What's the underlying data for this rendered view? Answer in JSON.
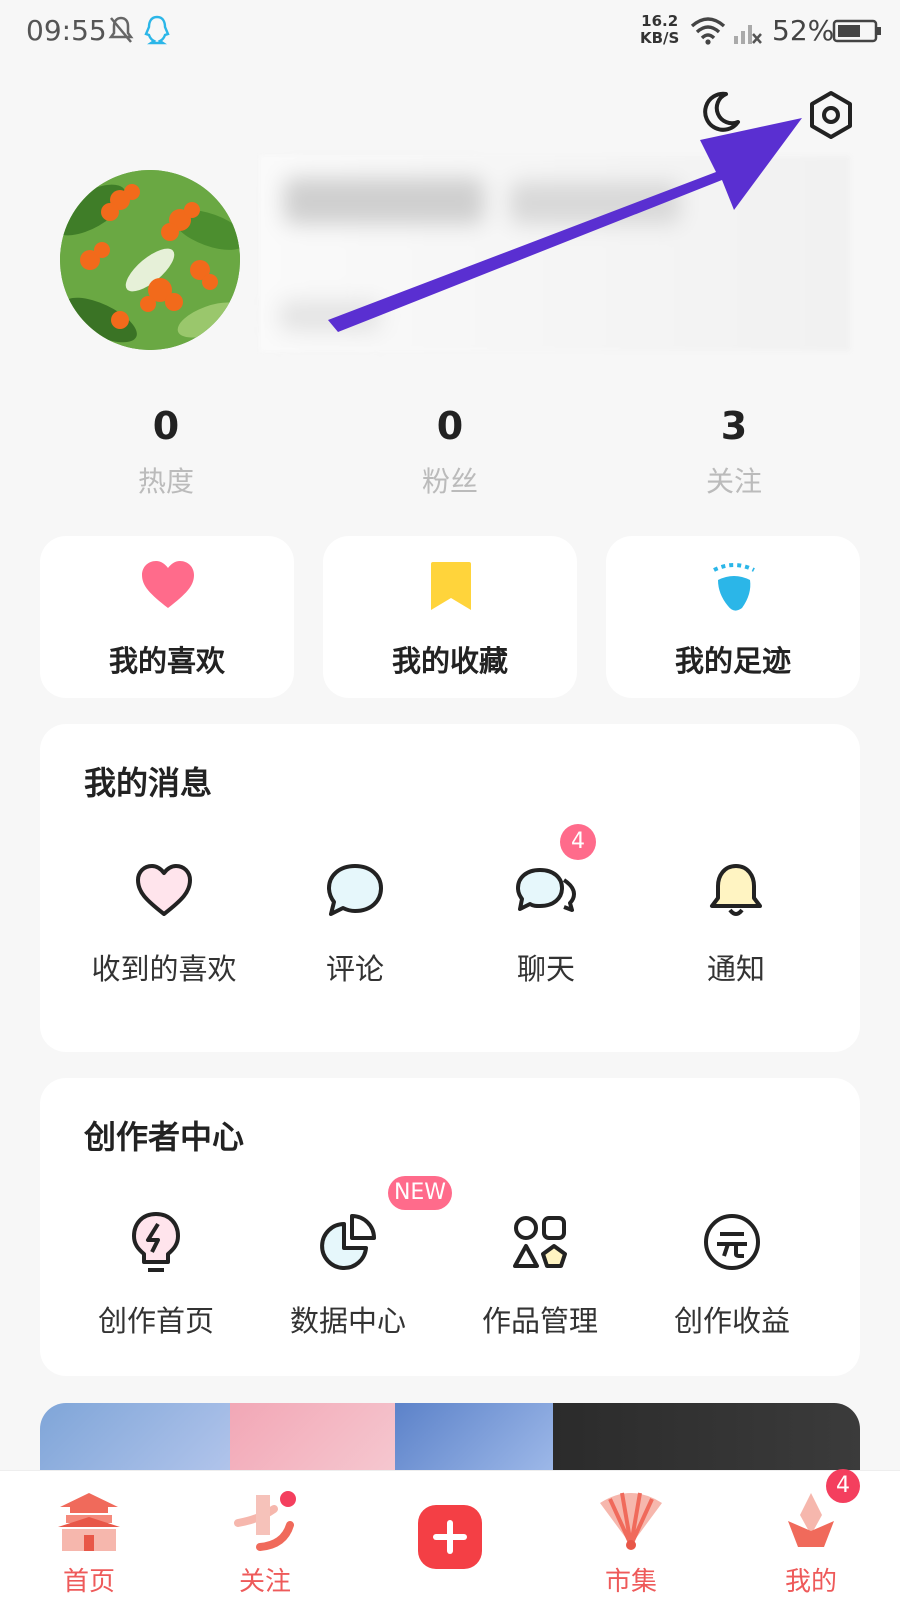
{
  "status_bar": {
    "time": "09:55",
    "net_speed_value": "16.2",
    "net_speed_unit": "KB/S",
    "battery": "52%",
    "icons": [
      "mute-icon",
      "qq-icon",
      "wifi-icon",
      "signal-icon",
      "battery-icon"
    ]
  },
  "header": {
    "icons": [
      "moon-icon",
      "settings-gear-icon"
    ]
  },
  "stats": [
    {
      "value": "0",
      "label": "热度"
    },
    {
      "value": "0",
      "label": "粉丝"
    },
    {
      "value": "3",
      "label": "关注"
    }
  ],
  "shortcuts": [
    {
      "label": "我的喜欢",
      "icon": "heart-icon",
      "color": "#ff6b8b"
    },
    {
      "label": "我的收藏",
      "icon": "bookmark-icon",
      "color": "#ffd43b"
    },
    {
      "label": "我的足迹",
      "icon": "footprint-icon",
      "color": "#2bb6e8"
    }
  ],
  "messages": {
    "title": "我的消息",
    "items": [
      {
        "label": "收到的喜欢",
        "icon": "heart-outline-icon"
      },
      {
        "label": "评论",
        "icon": "comment-icon"
      },
      {
        "label": "聊天",
        "icon": "chat-icon",
        "badge": "4"
      },
      {
        "label": "通知",
        "icon": "bell-icon"
      }
    ]
  },
  "creator": {
    "title": "创作者中心",
    "items": [
      {
        "label": "创作首页",
        "icon": "lightbulb-icon"
      },
      {
        "label": "数据中心",
        "icon": "pie-chart-icon",
        "badge": "NEW"
      },
      {
        "label": "作品管理",
        "icon": "shapes-icon"
      },
      {
        "label": "创作收益",
        "icon": "yuan-coin-icon"
      }
    ]
  },
  "bottom_nav": [
    {
      "label": "首页",
      "icon": "palace-icon"
    },
    {
      "label": "关注",
      "icon": "follow-icon"
    },
    {
      "label": "",
      "icon": "plus-icon"
    },
    {
      "label": "市集",
      "icon": "fan-icon"
    },
    {
      "label": "我的",
      "icon": "profile-icon",
      "badge": "4"
    }
  ],
  "colors": {
    "accent": "#ff6b8b",
    "nav_text": "#ee5a5a",
    "plus_button": "#f43f45",
    "arrow": "#5a2fd1"
  }
}
